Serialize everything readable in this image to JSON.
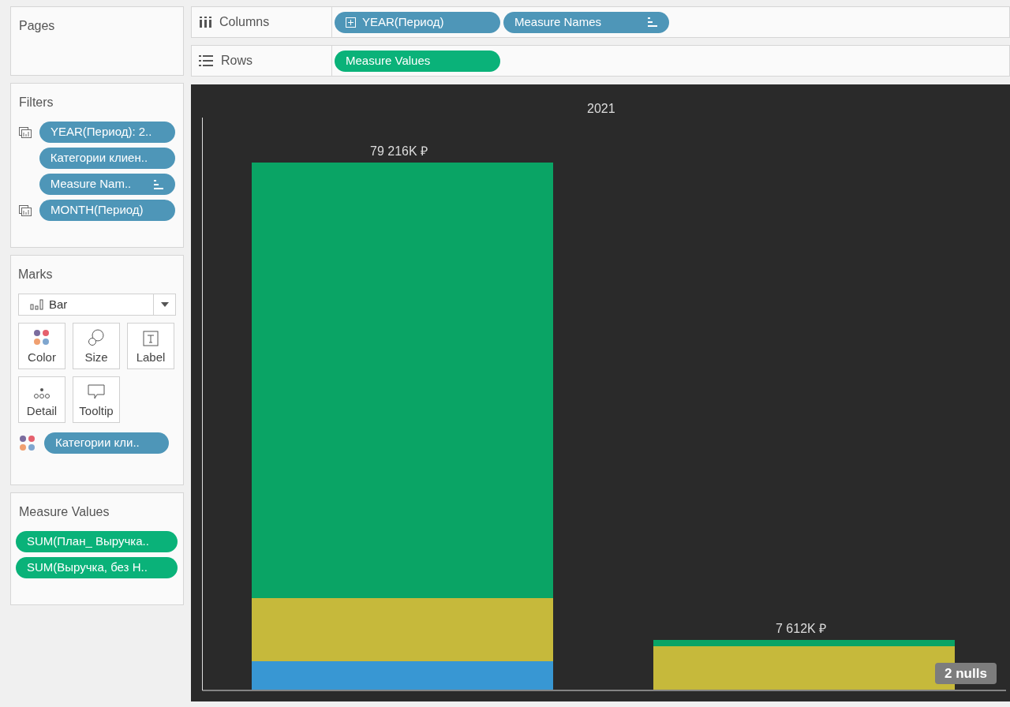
{
  "pages": {
    "title": "Pages"
  },
  "filters": {
    "title": "Filters",
    "pills": [
      {
        "text": "YEAR(Период): 2..",
        "color": "#4e96b8",
        "kind": "filter-date"
      },
      {
        "text": "Категории клиен..",
        "color": "#4e96b8"
      },
      {
        "text": "Measure Nam..",
        "color": "#4e96b8",
        "kind": "sorted"
      },
      {
        "text": "MONTH(Период)",
        "color": "#4e96b8",
        "kind": "filter-date"
      }
    ]
  },
  "marks": {
    "title": "Marks",
    "mark_type": "Bar",
    "cards": [
      {
        "label": "Color",
        "kind": "color"
      },
      {
        "label": "Size",
        "kind": "size"
      },
      {
        "label": "Label",
        "kind": "label"
      },
      {
        "label": "Detail",
        "kind": "detail"
      },
      {
        "label": "Tooltip",
        "kind": "tooltip"
      }
    ],
    "pills": [
      {
        "text": "Категории кли..",
        "color": "#4e96b8",
        "kind": "color"
      }
    ]
  },
  "measure_values": {
    "title": "Measure Values",
    "pills": [
      {
        "text": "SUM(План_ Выручка..",
        "color": "#0ab279"
      },
      {
        "text": "SUM(Выручка, без Н..",
        "color": "#0ab279"
      }
    ]
  },
  "shelves": [
    {
      "label": "Columns",
      "kind": "columns",
      "pills": [
        {
          "text": "YEAR(Период)",
          "color": "#4e96b8",
          "kind": "expand"
        },
        {
          "text": "Measure Names",
          "color": "#4e96b8",
          "kind": "sorted"
        }
      ]
    },
    {
      "label": "Rows",
      "kind": "rows",
      "pills": [
        {
          "text": "Measure Values",
          "color": "#0ab279"
        }
      ]
    }
  ],
  "view": {
    "header": "2021",
    "bar_labels": [
      "79 216K ₽",
      "7 612K ₽"
    ],
    "nulls_badge": "2 nulls"
  }
}
